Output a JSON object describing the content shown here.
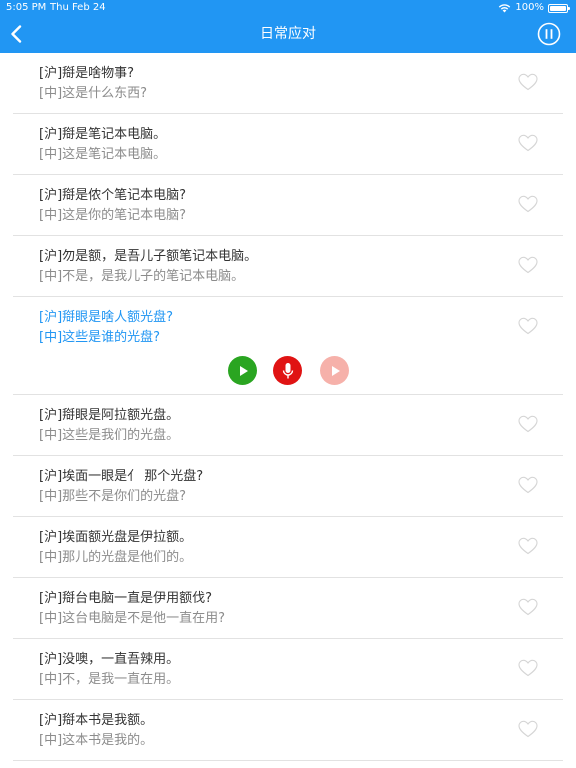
{
  "status_bar": {
    "time": "5:05 PM",
    "date": "Thu Feb 24",
    "battery": "100%"
  },
  "nav": {
    "title": "日常应对"
  },
  "phrases": [
    {
      "sh": "[沪]搿是啥物事?",
      "zh": "[中]这是什么东西?"
    },
    {
      "sh": "[沪]搿是笔记本电脑。",
      "zh": "[中]这是笔记本电脑。"
    },
    {
      "sh": "[沪]搿是侬个笔记本电脑?",
      "zh": "[中]这是你的笔记本电脑?"
    },
    {
      "sh": "[沪]勿是额，是吾儿子额笔记本电脑。",
      "zh": "[中]不是，是我儿子的笔记本电脑。"
    },
    {
      "sh": "[沪]搿眼是啥人额光盘?",
      "zh": "[中]这些是谁的光盘?"
    },
    {
      "sh": "[沪]搿眼是阿拉额光盘。",
      "zh": "[中]这些是我们的光盘。"
    },
    {
      "sh": "[沪]埃面一眼是亻 那个光盘?",
      "zh": "[中]那些不是你们的光盘?"
    },
    {
      "sh": "[沪]埃面额光盘是伊拉额。",
      "zh": "[中]那儿的光盘是他们的。"
    },
    {
      "sh": "[沪]搿台电脑一直是伊用额伐?",
      "zh": "[中]这台电脑是不是他一直在用?"
    },
    {
      "sh": "[沪]没噢，一直吾辣用。",
      "zh": "[中]不，是我一直在用。"
    },
    {
      "sh": "[沪]搿本书是我额。",
      "zh": "[中]这本书是我的。"
    }
  ],
  "colors": {
    "accent": "#2196f3",
    "play": "#2aa521",
    "record": "#e01313",
    "replay": "#f6b1aa"
  }
}
